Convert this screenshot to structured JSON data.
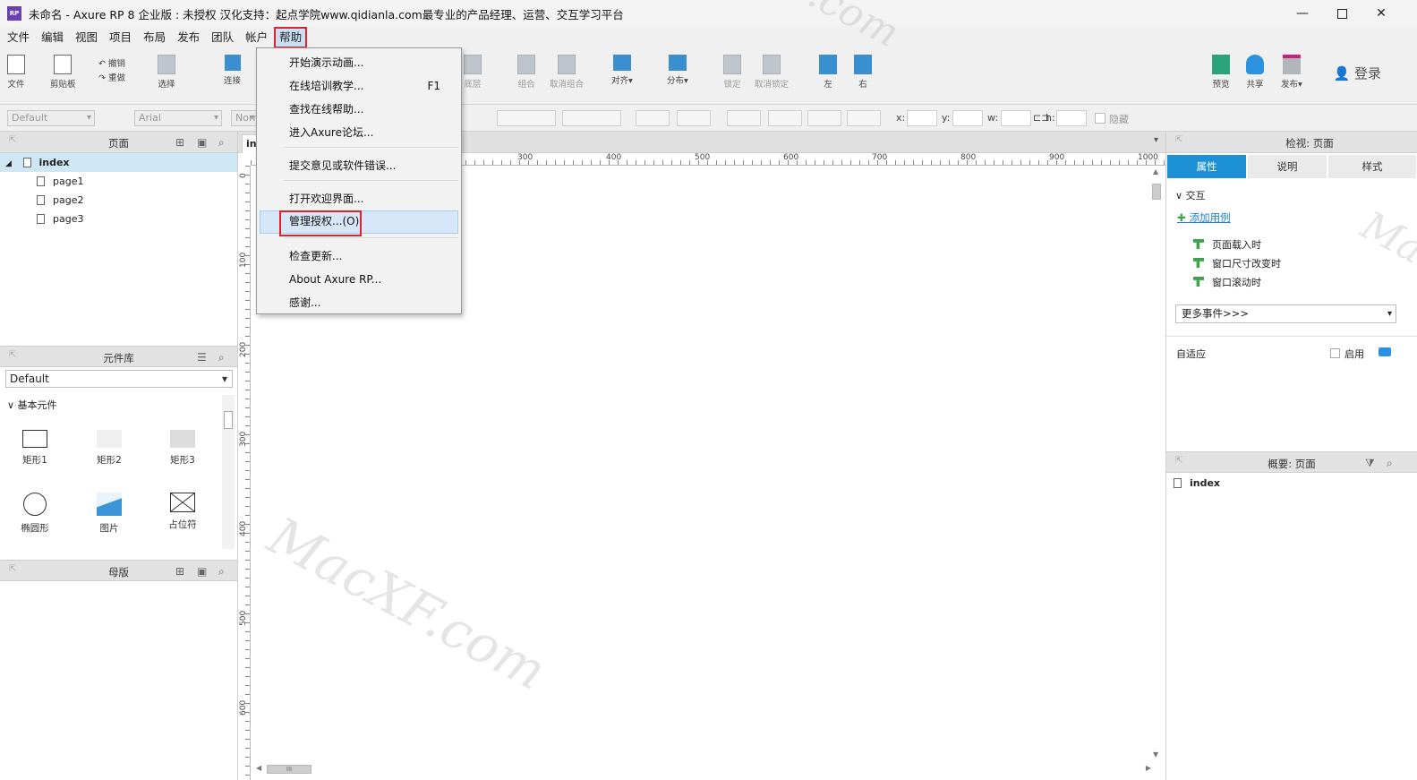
{
  "window": {
    "title": "未命名 - Axure RP 8 企业版 : 未授权 汉化支持：起点学院www.qidianla.com最专业的产品经理、运营、交互学习平台",
    "app_icon": "RP",
    "controls": [
      "minimize-icon",
      "maximize-icon",
      "close-icon"
    ]
  },
  "menubar": {
    "items": [
      "文件",
      "编辑",
      "视图",
      "项目",
      "布局",
      "发布",
      "团队",
      "帐户",
      "帮助"
    ],
    "active": "帮助"
  },
  "toolbar": {
    "file": "文件",
    "clipboard": "剪贴板",
    "undo": "撤销",
    "redo": "重做",
    "select": "选择",
    "connect": "连接",
    "bottom": "底层",
    "group": "组合",
    "ungroup": "取消组合",
    "align": "对齐▾",
    "distribute": "分布▾",
    "lock": "锁定",
    "unlock": "取消锁定",
    "left": "左",
    "right": "右",
    "preview": "预览",
    "share": "共享",
    "publish": "发布▾",
    "login": "登录"
  },
  "formatbar": {
    "style": "Default",
    "font": "Arial",
    "weight": "Norm",
    "x_label": "x:",
    "y_label": "y:",
    "w_label": "w:",
    "h_label": "h:",
    "hide_label": "隐藏"
  },
  "pages_panel": {
    "title": "页面",
    "root": "index",
    "children": [
      "page1",
      "page2",
      "page3"
    ]
  },
  "library_panel": {
    "title": "元件库",
    "selected_library": "Default",
    "group": "基本元件",
    "widgets": [
      "矩形1",
      "矩形2",
      "矩形3",
      "椭圆形",
      "图片",
      "占位符"
    ]
  },
  "masters_panel": {
    "title": "母版"
  },
  "canvas": {
    "tab": "index",
    "ruler_h": [
      "300",
      "400",
      "500",
      "600",
      "700",
      "800",
      "900",
      "1000"
    ],
    "ruler_v": [
      "0",
      "100",
      "200",
      "300",
      "400",
      "500",
      "600"
    ],
    "hscroll_thumb": "III"
  },
  "inspector": {
    "title": "检视: 页面",
    "tabs": [
      "属性",
      "说明",
      "样式"
    ],
    "active_tab": "属性",
    "section": "交互",
    "add_case": "添加用例",
    "events": [
      "页面载入时",
      "窗口尺寸改变时",
      "窗口滚动时"
    ],
    "more_events": "更多事件>>>",
    "adaptive": "自适应",
    "enable": "启用"
  },
  "outline_panel": {
    "title": "概要: 页面",
    "item": "index"
  },
  "help_menu": {
    "items": [
      {
        "label": "开始演示动画..."
      },
      {
        "label": "在线培训教学...",
        "hotkey": "F1"
      },
      {
        "label": "查找在线帮助..."
      },
      {
        "label": "进入Axure论坛..."
      },
      {
        "label": "提交意见或软件错误..."
      },
      {
        "label": "打开欢迎界面..."
      },
      {
        "label": "管理授权...(O)"
      },
      {
        "label": "检查更新..."
      },
      {
        "label": "About Axure RP..."
      },
      {
        "label": "感谢..."
      }
    ],
    "highlighted": "管理授权...(O)"
  },
  "watermarks": [
    "MacXF.com",
    ".com",
    "Ma"
  ],
  "colors": {
    "accent": "#1e90d6",
    "annotation": "#e0202a",
    "selected_row": "#cfe6f5"
  }
}
